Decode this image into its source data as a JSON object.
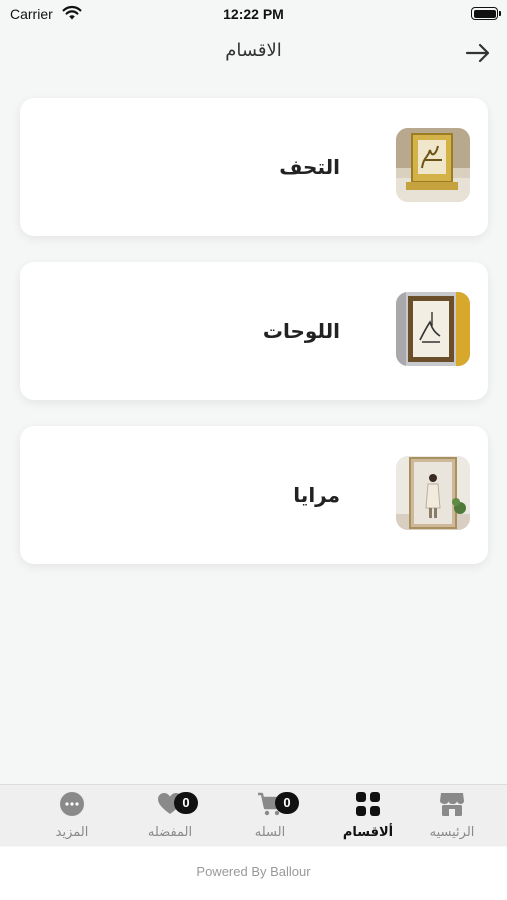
{
  "status_bar": {
    "carrier": "Carrier",
    "time": "12:22 PM"
  },
  "nav": {
    "title": "الاقسام",
    "back_icon": "arrow-right-icon"
  },
  "categories": [
    {
      "label": "التحف",
      "thumb": "gold-calligraphy-frame"
    },
    {
      "label": "اللوحات",
      "thumb": "framed-calligraphy-painting"
    },
    {
      "label": "مرايا",
      "thumb": "standing-mirror"
    }
  ],
  "tab_bar": {
    "active_color": "#111111",
    "inactive_color": "#8a8a8a",
    "items": [
      {
        "label": "المزيد",
        "icon": "more-dots-icon"
      },
      {
        "label": "المفضله",
        "icon": "heart-icon",
        "badge": "0"
      },
      {
        "label": "السله",
        "icon": "cart-icon",
        "badge": "0"
      },
      {
        "label": "ألاقسام",
        "icon": "grid-icon",
        "active": true
      },
      {
        "label": "الرئيسيه",
        "icon": "store-icon"
      }
    ]
  },
  "footer": {
    "powered_by": "Powered By Ballour"
  }
}
